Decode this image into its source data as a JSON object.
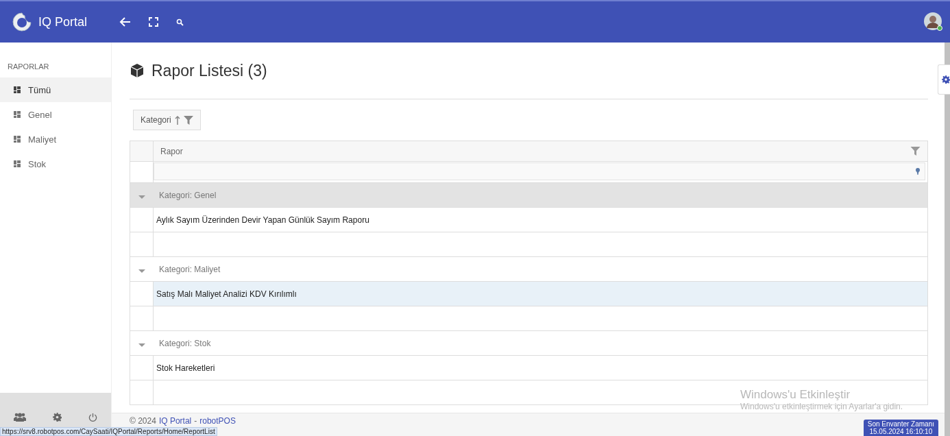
{
  "header": {
    "app_name": "IQ Portal"
  },
  "sidebar": {
    "section_title": "RAPORLAR",
    "items": [
      {
        "label": "Tümü",
        "selected": true
      },
      {
        "label": "Genel",
        "selected": false
      },
      {
        "label": "Maliyet",
        "selected": false
      },
      {
        "label": "Stok",
        "selected": false
      }
    ]
  },
  "page": {
    "title": "Rapor Listesi (3)"
  },
  "group_panel": {
    "chip": "Kategori"
  },
  "grid": {
    "columns": [
      "Rapor"
    ],
    "groups": [
      {
        "label": "Kategori: Genel",
        "selected": true,
        "rows": [
          {
            "text": "Aylık Sayım Üzerinden Devir Yapan Günlük Sayım Raporu",
            "selected": false
          }
        ]
      },
      {
        "label": "Kategori: Maliyet",
        "selected": false,
        "rows": [
          {
            "text": "Satış Malı Maliyet Analizi KDV Kırılımlı",
            "selected": true
          }
        ]
      },
      {
        "label": "Kategori: Stok",
        "selected": false,
        "rows": [
          {
            "text": "Stok Hareketleri",
            "selected": false
          }
        ]
      }
    ]
  },
  "footer": {
    "copyright": "© 2024",
    "link_1": "IQ Portal",
    "separator": "-",
    "link_2": "robotPOS"
  },
  "os_notice": {
    "title": "Windows'u Etkinleştir",
    "text": "Windows'u etkinleştirmek için Ayarlar'a gidin."
  },
  "status_url": "https://srv8.robotpos.com/CaySaati/IQPortal/Reports/Home/ReportList",
  "inventory_badge": {
    "label": "Son Envanter Zamanı",
    "time": "15.05.2024 16:10:10"
  }
}
